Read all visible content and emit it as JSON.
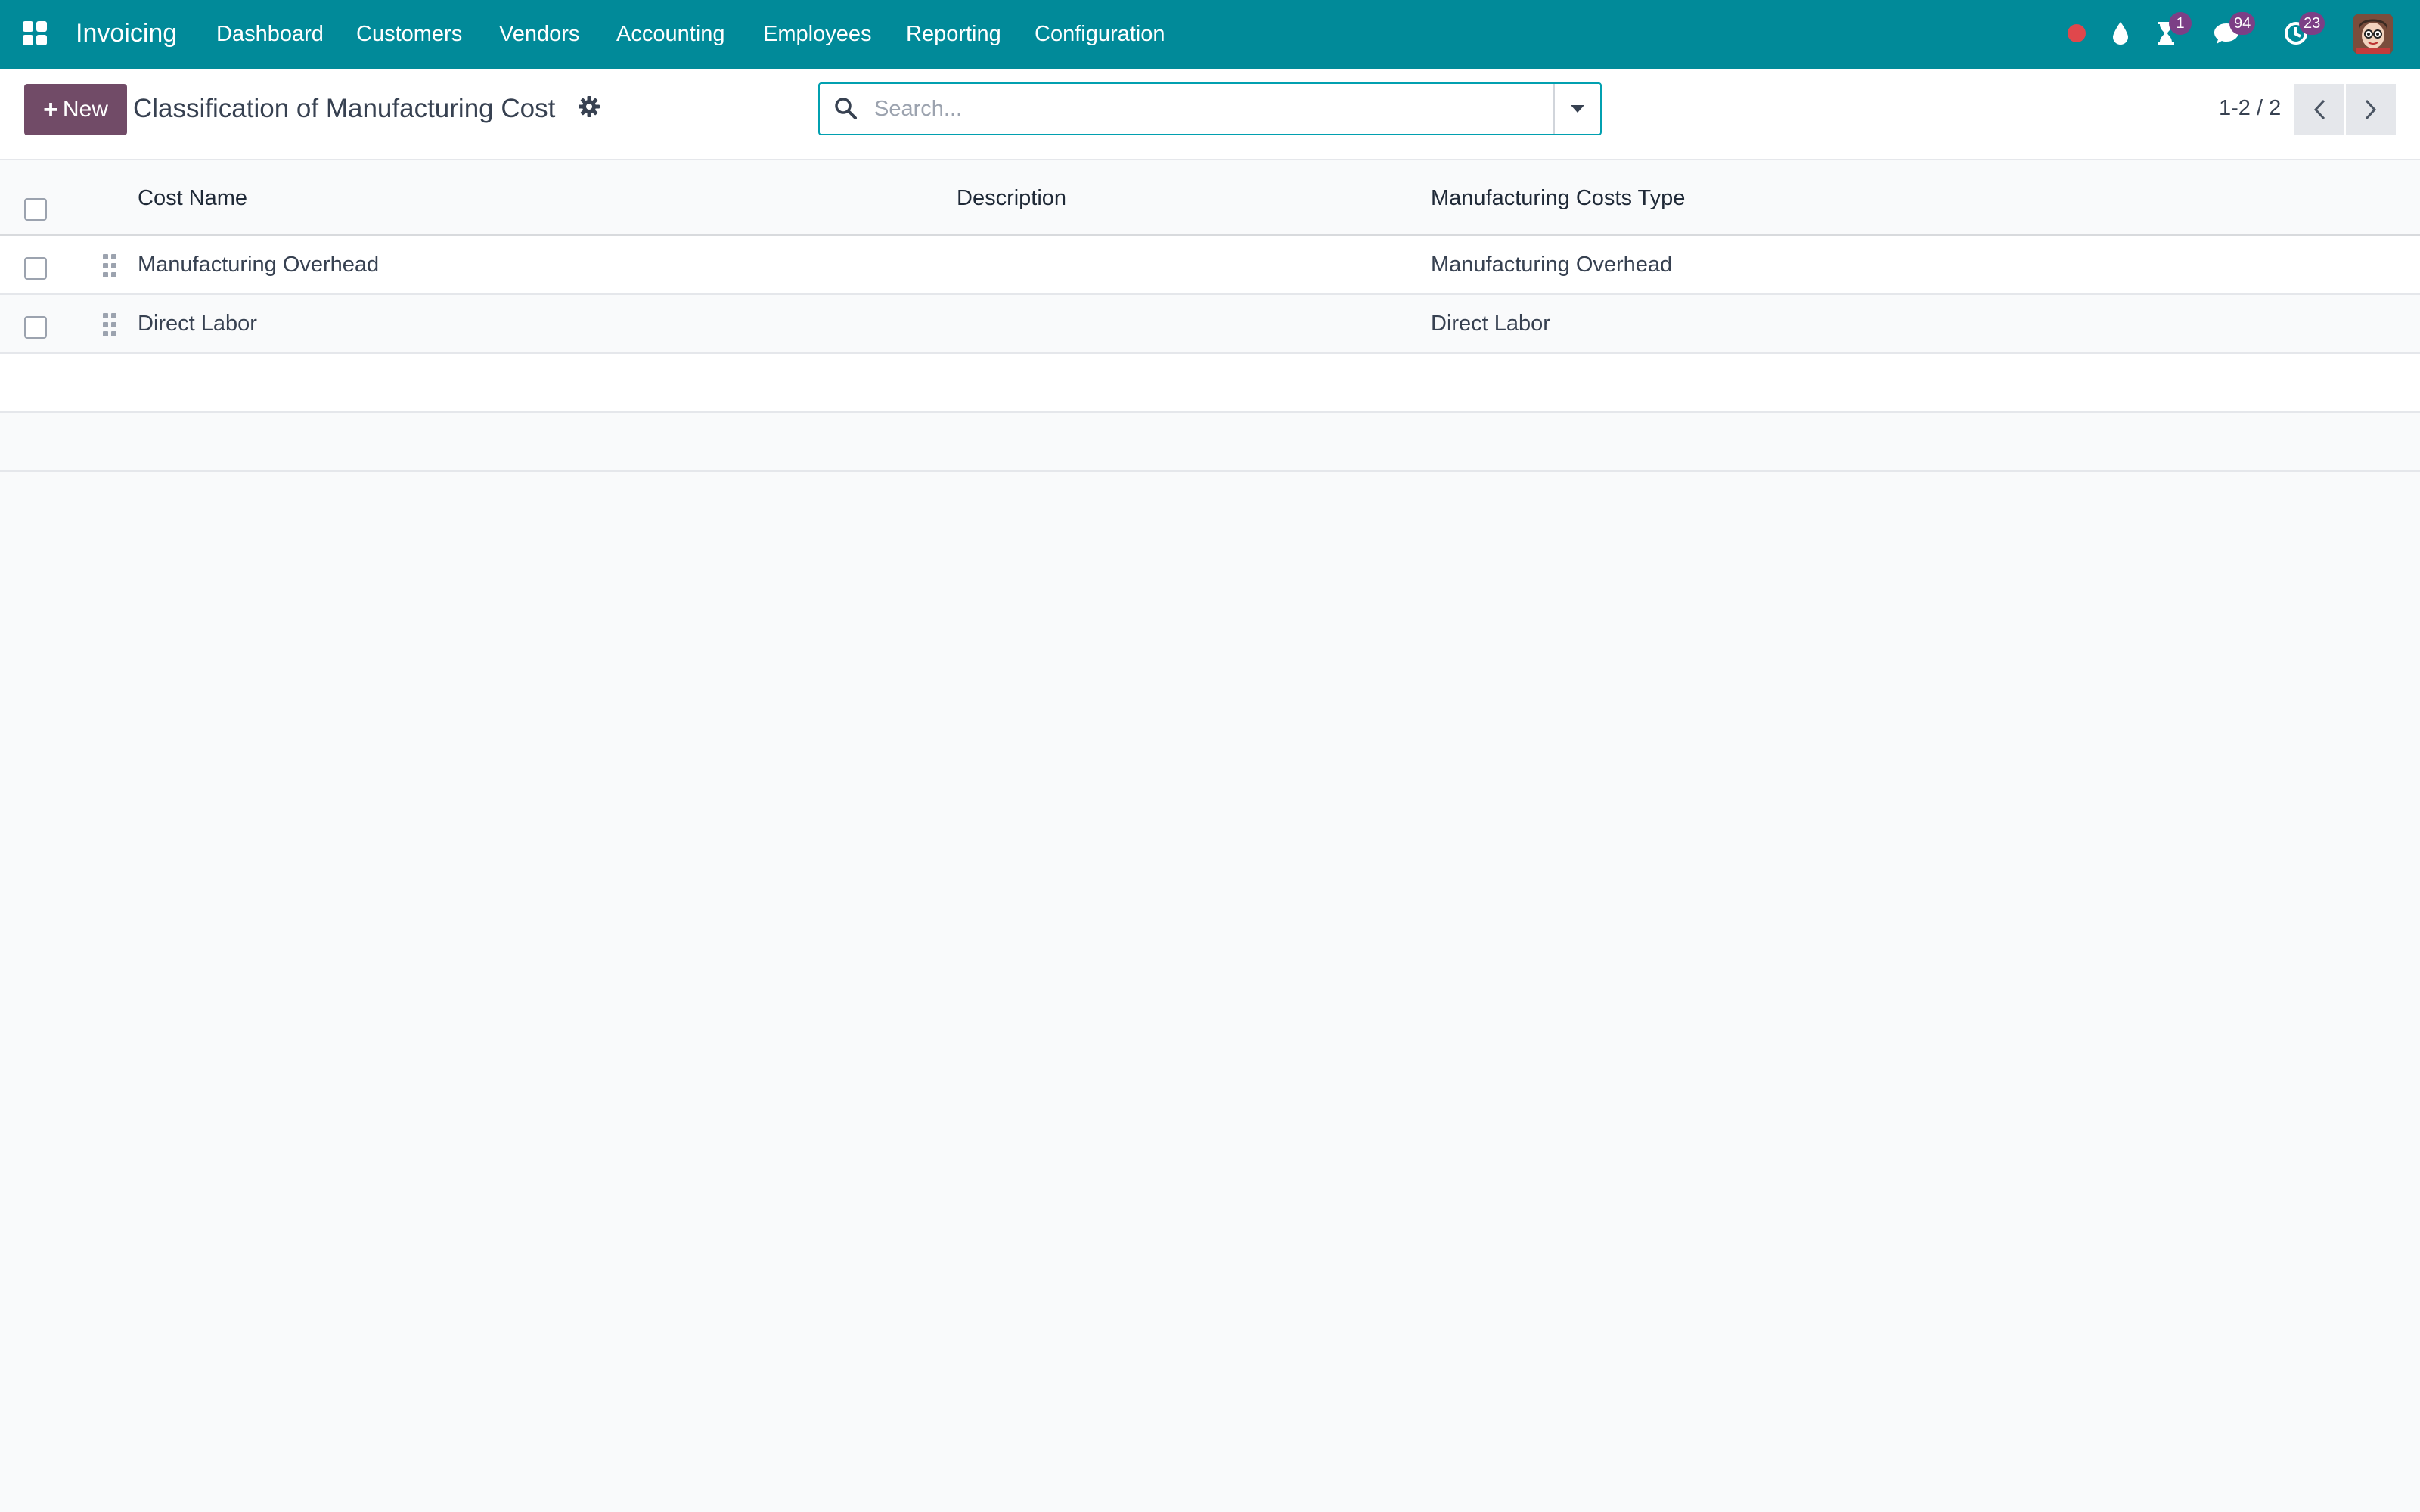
{
  "navbar": {
    "app_name": "Invoicing",
    "menu": [
      "Dashboard",
      "Customers",
      "Vendors",
      "Accounting",
      "Employees",
      "Reporting",
      "Configuration"
    ],
    "badges": {
      "activities": "1",
      "messages": "94",
      "updates": "23"
    },
    "colors": {
      "bar": "#018a99",
      "badge": "#7c3f86",
      "recording": "#e0474c"
    }
  },
  "control_panel": {
    "new_label": "New",
    "title": "Classification of Manufacturing Cost",
    "search_placeholder": "Search...",
    "pager": "1-2 / 2",
    "accent": "#714b67"
  },
  "table": {
    "columns": [
      "Cost Name",
      "Description",
      "Manufacturing Costs Type"
    ],
    "rows": [
      {
        "cost_name": "Manufacturing Overhead",
        "description": "",
        "type": "Manufacturing Overhead"
      },
      {
        "cost_name": "Direct Labor",
        "description": "",
        "type": "Direct Labor"
      }
    ]
  }
}
